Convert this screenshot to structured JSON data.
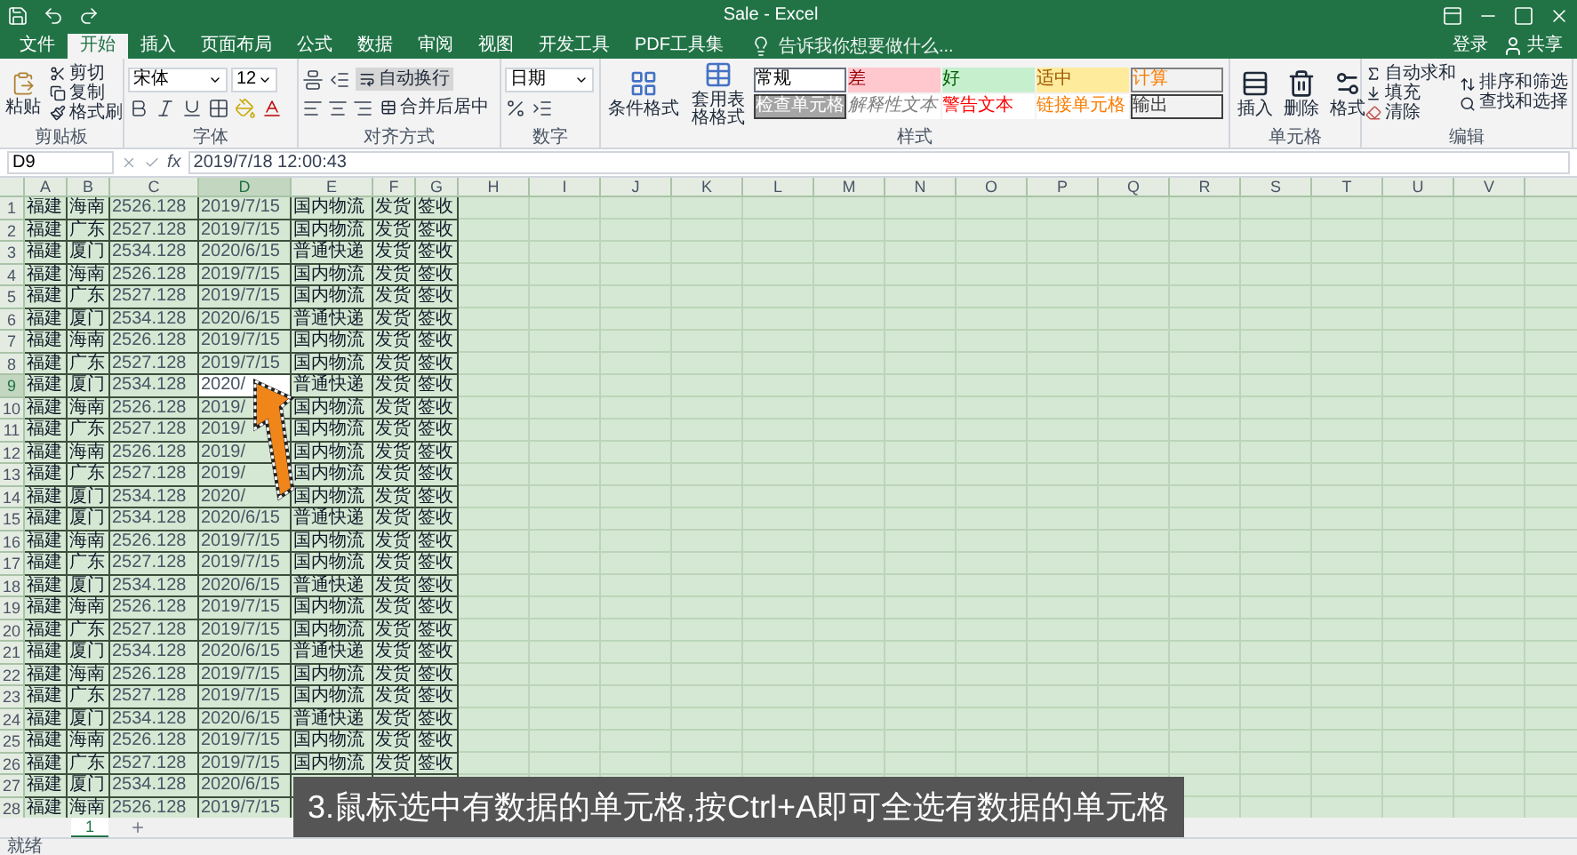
{
  "window": {
    "title": "Sale - Excel",
    "sign_in": "登录",
    "share": "共享"
  },
  "ribbon_tabs": [
    {
      "label": "文件",
      "selected": false
    },
    {
      "label": "开始",
      "selected": true
    },
    {
      "label": "插入",
      "selected": false
    },
    {
      "label": "页面布局",
      "selected": false
    },
    {
      "label": "公式",
      "selected": false
    },
    {
      "label": "数据",
      "selected": false
    },
    {
      "label": "审阅",
      "selected": false
    },
    {
      "label": "视图",
      "selected": false
    },
    {
      "label": "开发工具",
      "selected": false
    },
    {
      "label": "PDF工具集",
      "selected": false
    }
  ],
  "tell_me": {
    "placeholder": "告诉我你想要做什么..."
  },
  "clipboard": {
    "paste": "粘贴",
    "cut": "剪切",
    "copy": "复制",
    "format_painter": "格式刷",
    "label": "剪贴板"
  },
  "font": {
    "name": "宋体",
    "size": "12",
    "label": "字体"
  },
  "alignment": {
    "wrap": "自动换行",
    "merge": "合并后居中",
    "label": "对齐方式"
  },
  "number": {
    "format": "日期",
    "label": "数字"
  },
  "styles": {
    "conditional": "条件格式",
    "table": "套用表格格式",
    "label": "样式",
    "items": [
      {
        "label": "常规",
        "kind": "normal"
      },
      {
        "label": "差",
        "kind": "bad"
      },
      {
        "label": "好",
        "kind": "good"
      },
      {
        "label": "适中",
        "kind": "neutral"
      },
      {
        "label": "计算",
        "kind": "calculation"
      },
      {
        "label": "检查单元格",
        "kind": "check"
      },
      {
        "label": "解释性文本",
        "kind": "explanatory"
      },
      {
        "label": "警告文本",
        "kind": "warning"
      },
      {
        "label": "链接单元格",
        "kind": "linked"
      },
      {
        "label": "输出",
        "kind": "output"
      }
    ]
  },
  "cells_group": {
    "insert": "插入",
    "delete": "删除",
    "format": "格式",
    "label": "单元格"
  },
  "editing": {
    "autosum": "自动求和",
    "fill": "填充",
    "clear": "清除",
    "sort": "排序和筛选",
    "find": "查找和选择",
    "label": "编辑"
  },
  "formula_bar": {
    "name_box": "D9",
    "fx": "fx",
    "value": "2019/7/18 12:00:43"
  },
  "sheet": {
    "columns": [
      {
        "label": "A",
        "selected": false
      },
      {
        "label": "B",
        "selected": false
      },
      {
        "label": "C",
        "selected": false
      },
      {
        "label": "D",
        "selected": true
      },
      {
        "label": "E",
        "selected": false
      },
      {
        "label": "F",
        "selected": false
      },
      {
        "label": "G",
        "selected": false
      },
      {
        "label": "H",
        "selected": false
      },
      {
        "label": "I",
        "selected": false
      },
      {
        "label": "J",
        "selected": false
      },
      {
        "label": "K",
        "selected": false
      },
      {
        "label": "L",
        "selected": false
      },
      {
        "label": "M",
        "selected": false
      },
      {
        "label": "N",
        "selected": false
      },
      {
        "label": "O",
        "selected": false
      },
      {
        "label": "P",
        "selected": false
      },
      {
        "label": "Q",
        "selected": false
      },
      {
        "label": "R",
        "selected": false
      },
      {
        "label": "S",
        "selected": false
      },
      {
        "label": "T",
        "selected": false
      },
      {
        "label": "U",
        "selected": false
      },
      {
        "label": "V",
        "selected": false
      }
    ],
    "rows": [
      {
        "number": "1",
        "selected": false,
        "cells": [
          "福建",
          "海南",
          "2526.128",
          "2019/7/15",
          "国内物流",
          "发货",
          "签收"
        ]
      },
      {
        "number": "2",
        "selected": false,
        "cells": [
          "福建",
          "广东",
          "2527.128",
          "2019/7/15",
          "国内物流",
          "发货",
          "签收"
        ]
      },
      {
        "number": "3",
        "selected": false,
        "cells": [
          "福建",
          "厦门",
          "2534.128",
          "2020/6/15",
          "普通快递",
          "发货",
          "签收"
        ]
      },
      {
        "number": "4",
        "selected": false,
        "cells": [
          "福建",
          "海南",
          "2526.128",
          "2019/7/15",
          "国内物流",
          "发货",
          "签收"
        ]
      },
      {
        "number": "5",
        "selected": false,
        "cells": [
          "福建",
          "广东",
          "2527.128",
          "2019/7/15",
          "国内物流",
          "发货",
          "签收"
        ]
      },
      {
        "number": "6",
        "selected": false,
        "cells": [
          "福建",
          "厦门",
          "2534.128",
          "2020/6/15",
          "普通快递",
          "发货",
          "签收"
        ]
      },
      {
        "number": "7",
        "selected": false,
        "cells": [
          "福建",
          "海南",
          "2526.128",
          "2019/7/15",
          "国内物流",
          "发货",
          "签收"
        ]
      },
      {
        "number": "8",
        "selected": false,
        "cells": [
          "福建",
          "广东",
          "2527.128",
          "2019/7/15",
          "国内物流",
          "发货",
          "签收"
        ]
      },
      {
        "number": "9",
        "selected": true,
        "cells": [
          "福建",
          "厦门",
          "2534.128",
          "2020/",
          "普通快递",
          "发货",
          "签收"
        ]
      },
      {
        "number": "10",
        "selected": false,
        "cells": [
          "福建",
          "海南",
          "2526.128",
          "2019/",
          "国内物流",
          "发货",
          "签收"
        ]
      },
      {
        "number": "11",
        "selected": false,
        "cells": [
          "福建",
          "广东",
          "2527.128",
          "2019/",
          "国内物流",
          "发货",
          "签收"
        ]
      },
      {
        "number": "12",
        "selected": false,
        "cells": [
          "福建",
          "海南",
          "2526.128",
          "2019/",
          "国内物流",
          "发货",
          "签收"
        ]
      },
      {
        "number": "13",
        "selected": false,
        "cells": [
          "福建",
          "广东",
          "2527.128",
          "2019/",
          "国内物流",
          "发货",
          "签收"
        ]
      },
      {
        "number": "14",
        "selected": false,
        "cells": [
          "福建",
          "厦门",
          "2534.128",
          "2020/",
          "国内物流",
          "发货",
          "签收"
        ]
      },
      {
        "number": "15",
        "selected": false,
        "cells": [
          "福建",
          "厦门",
          "2534.128",
          "2020/6/15",
          "普通快递",
          "发货",
          "签收"
        ]
      },
      {
        "number": "16",
        "selected": false,
        "cells": [
          "福建",
          "海南",
          "2526.128",
          "2019/7/15",
          "国内物流",
          "发货",
          "签收"
        ]
      },
      {
        "number": "17",
        "selected": false,
        "cells": [
          "福建",
          "广东",
          "2527.128",
          "2019/7/15",
          "国内物流",
          "发货",
          "签收"
        ]
      },
      {
        "number": "18",
        "selected": false,
        "cells": [
          "福建",
          "厦门",
          "2534.128",
          "2020/6/15",
          "普通快递",
          "发货",
          "签收"
        ]
      },
      {
        "number": "19",
        "selected": false,
        "cells": [
          "福建",
          "海南",
          "2526.128",
          "2019/7/15",
          "国内物流",
          "发货",
          "签收"
        ]
      },
      {
        "number": "20",
        "selected": false,
        "cells": [
          "福建",
          "广东",
          "2527.128",
          "2019/7/15",
          "国内物流",
          "发货",
          "签收"
        ]
      },
      {
        "number": "21",
        "selected": false,
        "cells": [
          "福建",
          "厦门",
          "2534.128",
          "2020/6/15",
          "普通快递",
          "发货",
          "签收"
        ]
      },
      {
        "number": "22",
        "selected": false,
        "cells": [
          "福建",
          "海南",
          "2526.128",
          "2019/7/15",
          "国内物流",
          "发货",
          "签收"
        ]
      },
      {
        "number": "23",
        "selected": false,
        "cells": [
          "福建",
          "广东",
          "2527.128",
          "2019/7/15",
          "国内物流",
          "发货",
          "签收"
        ]
      },
      {
        "number": "24",
        "selected": false,
        "cells": [
          "福建",
          "厦门",
          "2534.128",
          "2020/6/15",
          "普通快递",
          "发货",
          "签收"
        ]
      },
      {
        "number": "25",
        "selected": false,
        "cells": [
          "福建",
          "海南",
          "2526.128",
          "2019/7/15",
          "国内物流",
          "发货",
          "签收"
        ]
      },
      {
        "number": "26",
        "selected": false,
        "cells": [
          "福建",
          "广东",
          "2527.128",
          "2019/7/15",
          "国内物流",
          "发货",
          "签收"
        ]
      },
      {
        "number": "27",
        "selected": false,
        "cells": [
          "福建",
          "厦门",
          "2534.128",
          "2020/6/15"
        ]
      },
      {
        "number": "28",
        "selected": false,
        "cells": [
          "福建",
          "海南",
          "2526.128",
          "2019/7/15"
        ]
      }
    ]
  },
  "sheet_tabs": [
    {
      "label": "1",
      "selected": true
    }
  ],
  "status_bar": {
    "text": "就绪"
  },
  "caption": "3.鼠标选中有数据的单元格,按Ctrl+A即可全选有数据的单元格"
}
